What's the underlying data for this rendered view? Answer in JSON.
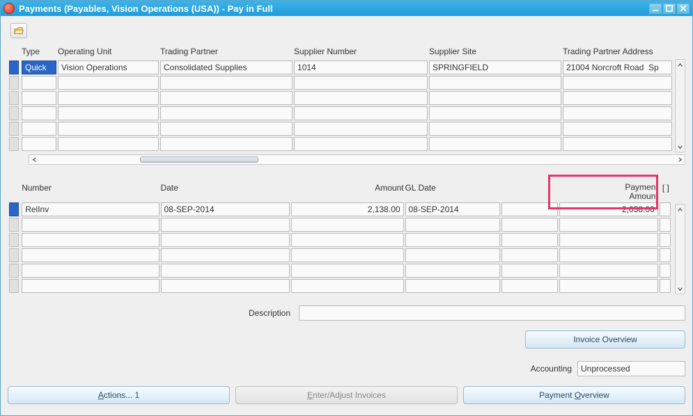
{
  "window": {
    "title": "Payments (Payables, Vision Operations (USA)) - Pay in Full"
  },
  "grid1": {
    "headers": {
      "type": "Type",
      "operating_unit": "Operating Unit",
      "trading_partner": "Trading Partner",
      "supplier_number": "Supplier Number",
      "supplier_site": "Supplier Site",
      "trading_partner_address": "Trading Partner Address"
    },
    "rows": [
      {
        "type": "Quick",
        "operating_unit": "Vision Operations",
        "trading_partner": "Consolidated Supplies",
        "supplier_number": "1014",
        "supplier_site": "SPRINGFIELD",
        "trading_partner_address": "21004 Norcroft Road  Sp"
      }
    ]
  },
  "grid2": {
    "headers": {
      "number": "Number",
      "date": "Date",
      "amount": "Amount",
      "gl_date": "GL Date",
      "payment_amount_l1": "Payment",
      "payment_amount_l2": "Amount",
      "flag": "[ ]"
    },
    "rows": [
      {
        "number": "RelInv",
        "date": "08-SEP-2014",
        "amount": "2,138.00",
        "gl_date": "08-SEP-2014",
        "blank1": "",
        "payment_amount": "2,058.00",
        "flag": ""
      }
    ]
  },
  "description": {
    "label": "Description",
    "value": ""
  },
  "buttons": {
    "invoice_overview": "Invoice Overview",
    "actions": "Actions... 1",
    "actions_u": "A",
    "enter_adjust": "Enter/Adjust Invoices",
    "enter_adjust_u": "E",
    "payment_overview": "Payment Overview",
    "payment_overview_u": "O"
  },
  "accounting": {
    "label": "Accounting",
    "value": "Unprocessed"
  }
}
